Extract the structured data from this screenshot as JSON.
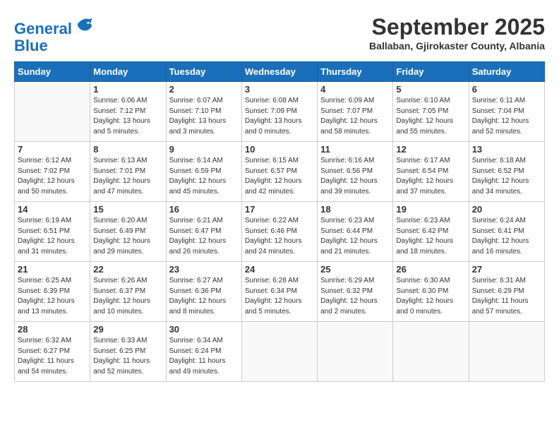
{
  "header": {
    "logo_line1": "General",
    "logo_line2": "Blue",
    "month": "September 2025",
    "location": "Ballaban, Gjirokaster County, Albania"
  },
  "weekdays": [
    "Sunday",
    "Monday",
    "Tuesday",
    "Wednesday",
    "Thursday",
    "Friday",
    "Saturday"
  ],
  "weeks": [
    [
      {
        "day": "",
        "info": ""
      },
      {
        "day": "1",
        "info": "Sunrise: 6:06 AM\nSunset: 7:12 PM\nDaylight: 13 hours\nand 5 minutes."
      },
      {
        "day": "2",
        "info": "Sunrise: 6:07 AM\nSunset: 7:10 PM\nDaylight: 13 hours\nand 3 minutes."
      },
      {
        "day": "3",
        "info": "Sunrise: 6:08 AM\nSunset: 7:09 PM\nDaylight: 13 hours\nand 0 minutes."
      },
      {
        "day": "4",
        "info": "Sunrise: 6:09 AM\nSunset: 7:07 PM\nDaylight: 12 hours\nand 58 minutes."
      },
      {
        "day": "5",
        "info": "Sunrise: 6:10 AM\nSunset: 7:05 PM\nDaylight: 12 hours\nand 55 minutes."
      },
      {
        "day": "6",
        "info": "Sunrise: 6:11 AM\nSunset: 7:04 PM\nDaylight: 12 hours\nand 52 minutes."
      }
    ],
    [
      {
        "day": "7",
        "info": "Sunrise: 6:12 AM\nSunset: 7:02 PM\nDaylight: 12 hours\nand 50 minutes."
      },
      {
        "day": "8",
        "info": "Sunrise: 6:13 AM\nSunset: 7:01 PM\nDaylight: 12 hours\nand 47 minutes."
      },
      {
        "day": "9",
        "info": "Sunrise: 6:14 AM\nSunset: 6:59 PM\nDaylight: 12 hours\nand 45 minutes."
      },
      {
        "day": "10",
        "info": "Sunrise: 6:15 AM\nSunset: 6:57 PM\nDaylight: 12 hours\nand 42 minutes."
      },
      {
        "day": "11",
        "info": "Sunrise: 6:16 AM\nSunset: 6:56 PM\nDaylight: 12 hours\nand 39 minutes."
      },
      {
        "day": "12",
        "info": "Sunrise: 6:17 AM\nSunset: 6:54 PM\nDaylight: 12 hours\nand 37 minutes."
      },
      {
        "day": "13",
        "info": "Sunrise: 6:18 AM\nSunset: 6:52 PM\nDaylight: 12 hours\nand 34 minutes."
      }
    ],
    [
      {
        "day": "14",
        "info": "Sunrise: 6:19 AM\nSunset: 6:51 PM\nDaylight: 12 hours\nand 31 minutes."
      },
      {
        "day": "15",
        "info": "Sunrise: 6:20 AM\nSunset: 6:49 PM\nDaylight: 12 hours\nand 29 minutes."
      },
      {
        "day": "16",
        "info": "Sunrise: 6:21 AM\nSunset: 6:47 PM\nDaylight: 12 hours\nand 26 minutes."
      },
      {
        "day": "17",
        "info": "Sunrise: 6:22 AM\nSunset: 6:46 PM\nDaylight: 12 hours\nand 24 minutes."
      },
      {
        "day": "18",
        "info": "Sunrise: 6:23 AM\nSunset: 6:44 PM\nDaylight: 12 hours\nand 21 minutes."
      },
      {
        "day": "19",
        "info": "Sunrise: 6:23 AM\nSunset: 6:42 PM\nDaylight: 12 hours\nand 18 minutes."
      },
      {
        "day": "20",
        "info": "Sunrise: 6:24 AM\nSunset: 6:41 PM\nDaylight: 12 hours\nand 16 minutes."
      }
    ],
    [
      {
        "day": "21",
        "info": "Sunrise: 6:25 AM\nSunset: 6:39 PM\nDaylight: 12 hours\nand 13 minutes."
      },
      {
        "day": "22",
        "info": "Sunrise: 6:26 AM\nSunset: 6:37 PM\nDaylight: 12 hours\nand 10 minutes."
      },
      {
        "day": "23",
        "info": "Sunrise: 6:27 AM\nSunset: 6:36 PM\nDaylight: 12 hours\nand 8 minutes."
      },
      {
        "day": "24",
        "info": "Sunrise: 6:28 AM\nSunset: 6:34 PM\nDaylight: 12 hours\nand 5 minutes."
      },
      {
        "day": "25",
        "info": "Sunrise: 6:29 AM\nSunset: 6:32 PM\nDaylight: 12 hours\nand 2 minutes."
      },
      {
        "day": "26",
        "info": "Sunrise: 6:30 AM\nSunset: 6:30 PM\nDaylight: 12 hours\nand 0 minutes."
      },
      {
        "day": "27",
        "info": "Sunrise: 6:31 AM\nSunset: 6:29 PM\nDaylight: 11 hours\nand 57 minutes."
      }
    ],
    [
      {
        "day": "28",
        "info": "Sunrise: 6:32 AM\nSunset: 6:27 PM\nDaylight: 11 hours\nand 54 minutes."
      },
      {
        "day": "29",
        "info": "Sunrise: 6:33 AM\nSunset: 6:25 PM\nDaylight: 11 hours\nand 52 minutes."
      },
      {
        "day": "30",
        "info": "Sunrise: 6:34 AM\nSunset: 6:24 PM\nDaylight: 11 hours\nand 49 minutes."
      },
      {
        "day": "",
        "info": ""
      },
      {
        "day": "",
        "info": ""
      },
      {
        "day": "",
        "info": ""
      },
      {
        "day": "",
        "info": ""
      }
    ]
  ]
}
